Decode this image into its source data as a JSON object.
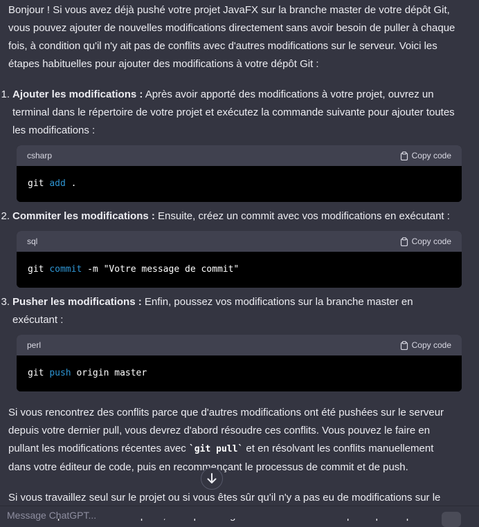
{
  "intro": "Bonjour ! Si vous avez déjà pushé votre projet JavaFX sur la branche master de votre dépôt Git, vous pouvez ajouter de nouvelles modifications directement sans avoir besoin de puller à chaque fois, à condition qu'il n'y ait pas de conflits avec d'autres modifications sur le serveur. Voici les étapes habituelles pour ajouter des modifications à votre dépôt Git :",
  "steps": [
    {
      "num": "1.",
      "title": "Ajouter les modifications :",
      "text": " Après avoir apporté des modifications à votre projet, ouvrez un terminal dans le répertoire de votre projet et exécutez la commande suivante pour ajouter toutes les modifications :",
      "lang": "csharp",
      "code_a": "git ",
      "code_kw": "add",
      "code_b": " ."
    },
    {
      "num": "2.",
      "title": "Commiter les modifications :",
      "text": " Ensuite, créez un commit avec vos modifications en exécutant :",
      "lang": "sql",
      "code_a": "git ",
      "code_kw": "commit",
      "code_b": " -m \"Votre message de commit\""
    },
    {
      "num": "3.",
      "title": "Pusher les modifications :",
      "text": " Enfin, poussez vos modifications sur la branche master en exécutant :",
      "lang": "perl",
      "code_a": "git ",
      "code_kw": "push",
      "code_b": " origin master"
    }
  ],
  "copy_label": "Copy code",
  "para1_a": "Si vous rencontrez des conflits parce que d'autres modifications ont été pushées sur le serveur depuis votre dernier pull, vous devrez d'abord résoudre ces conflits. Vous pouvez le faire en pullant les modifications récentes avec ",
  "para1_code": "`git pull`",
  "para1_b": " et en résolvant les conflits manuellement dans votre éditeur de code, puis en recommençant le processus de commit et de push.",
  "para2": "Si vous travaillez seul sur le projet ou si vous êtes sûr qu'il n'y a pas eu de modifications sur le serveur depuis votre dernier push, vous pouvez généralement sauter l'étape de pull et pusher",
  "input_placeholder": "Message ChatGPT..."
}
